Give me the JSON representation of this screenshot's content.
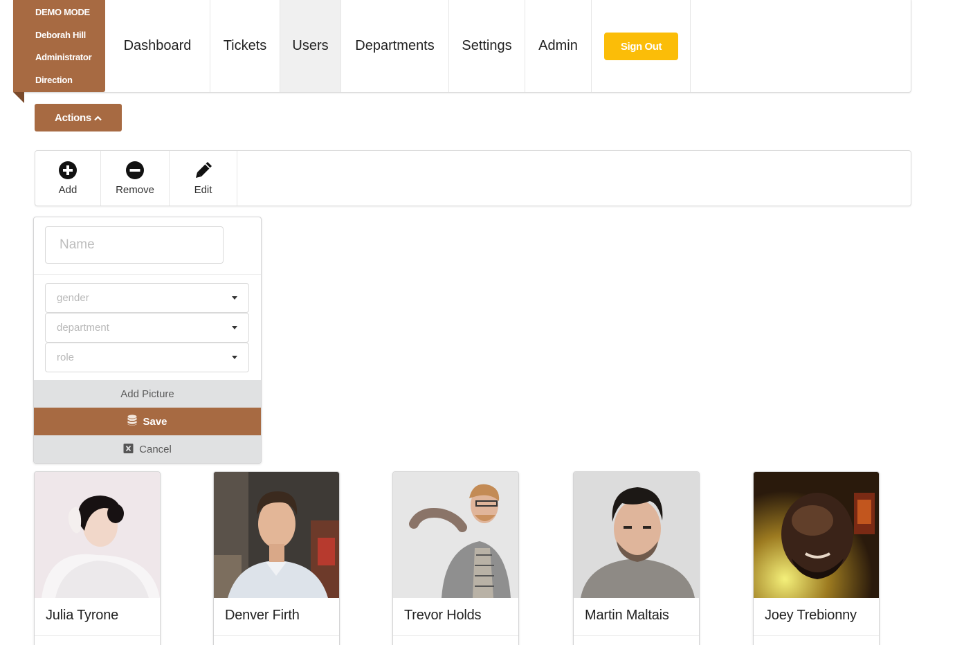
{
  "user_panel": {
    "mode": "DEMO MODE",
    "name": "Deborah Hill",
    "role": "Administrator",
    "department": "Direction"
  },
  "nav": {
    "items": [
      {
        "label": "Dashboard"
      },
      {
        "label": "Tickets"
      },
      {
        "label": "Users",
        "active": true
      },
      {
        "label": "Departments"
      },
      {
        "label": "Settings"
      },
      {
        "label": "Admin"
      }
    ],
    "signout_label": "Sign Out"
  },
  "actions": {
    "label": "Actions",
    "icon": "chevron-up-icon"
  },
  "toolbar": {
    "add_label": "Add",
    "remove_label": "Remove",
    "edit_label": "Edit"
  },
  "form": {
    "name_placeholder": "Name",
    "name_value": "",
    "gender_placeholder": "gender",
    "department_placeholder": "department",
    "role_placeholder": "role",
    "add_picture_label": "Add Picture",
    "save_label": "Save",
    "cancel_label": "Cancel"
  },
  "users": [
    {
      "name": "Julia Tyrone"
    },
    {
      "name": "Denver Firth"
    },
    {
      "name": "Trevor Holds"
    },
    {
      "name": "Martin Maltais"
    },
    {
      "name": "Joey Trebionny"
    }
  ],
  "colors": {
    "accent": "#a76a42",
    "signout": "#fbbd08",
    "secondary_button": "#e0e1e2"
  }
}
